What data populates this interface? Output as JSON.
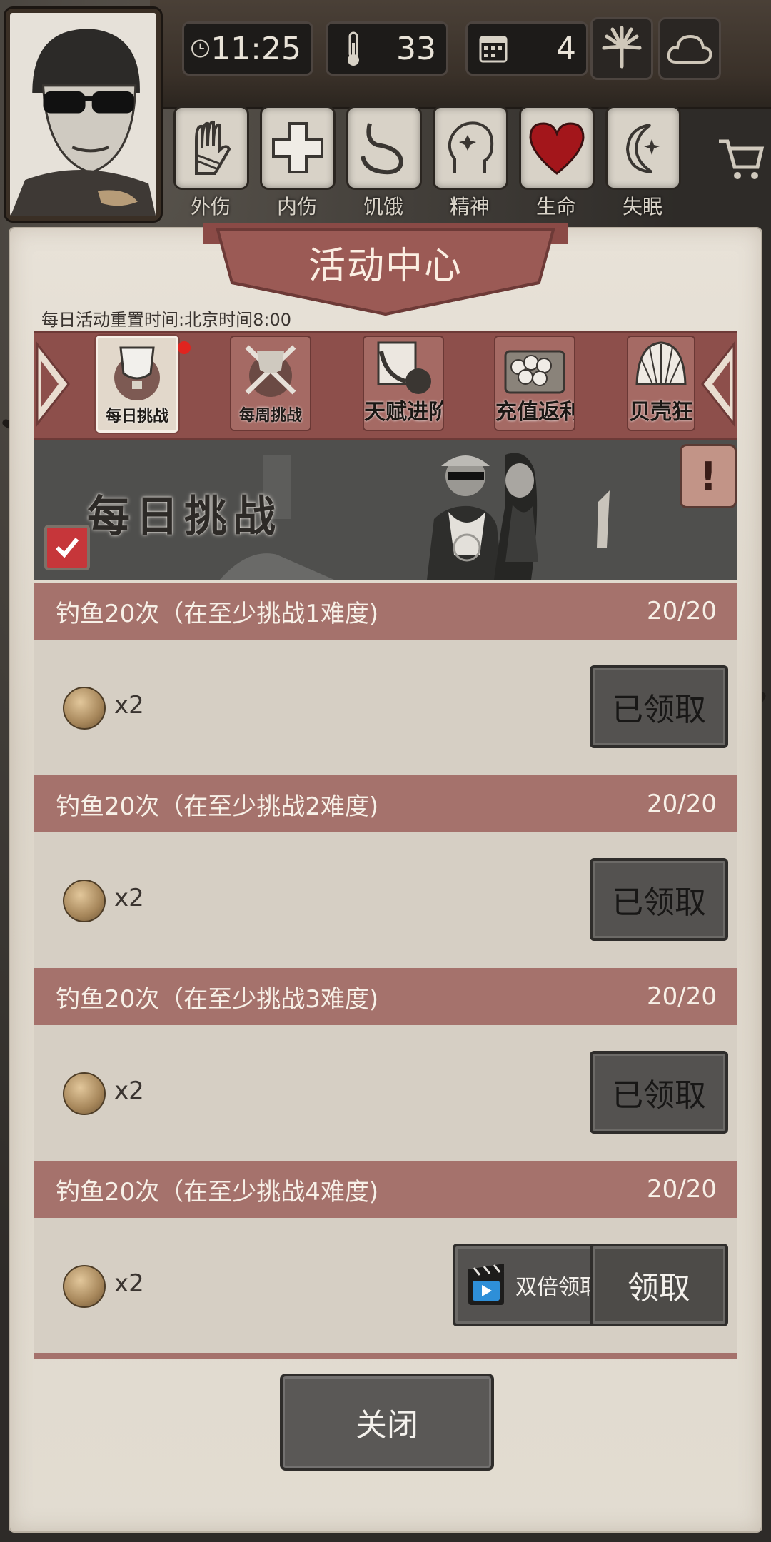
{
  "hud": {
    "time": "11:25",
    "temperature": "33",
    "day": "4",
    "icons": [
      "clock-icon",
      "thermometer-icon",
      "calendar-icon",
      "leaf-icon",
      "cloud-icon",
      "cart-icon"
    ]
  },
  "status": [
    {
      "label": "外伤",
      "icon": "bandaged-hand-icon"
    },
    {
      "label": "内伤",
      "icon": "medical-cross-icon"
    },
    {
      "label": "饥饿",
      "icon": "stomach-icon"
    },
    {
      "label": "精神",
      "icon": "head-icon"
    },
    {
      "label": "生命",
      "icon": "heart-icon"
    },
    {
      "label": "失眠",
      "icon": "moon-icon"
    }
  ],
  "panel": {
    "title": "活动中心",
    "reset_note": "每日活动重置时间:北京时间8:00"
  },
  "tabs": [
    {
      "label": "每日挑战",
      "icon": "trophy-icon",
      "active": true
    },
    {
      "label": "每周挑战",
      "icon": "weapons-icon",
      "active": false
    },
    {
      "label": "天赋进阶",
      "icon": "talent-icon",
      "active": false
    },
    {
      "label": "充值返利",
      "icon": "treasure-chest-icon",
      "active": false
    },
    {
      "label": "贝壳狂",
      "icon": "shell-icon",
      "active": false
    }
  ],
  "hero": {
    "title": "每日挑战",
    "info_label": "!"
  },
  "tasks": [
    {
      "name": "钓鱼20次（在至少挑战1难度)",
      "progress": "20/20",
      "reward_qty": "x2",
      "button": "已领取",
      "claimed": true
    },
    {
      "name": "钓鱼20次（在至少挑战2难度)",
      "progress": "20/20",
      "reward_qty": "x2",
      "button": "已领取",
      "claimed": true
    },
    {
      "name": "钓鱼20次（在至少挑战3难度)",
      "progress": "20/20",
      "reward_qty": "x2",
      "button": "已领取",
      "claimed": true
    },
    {
      "name": "钓鱼20次（在至少挑战4难度)",
      "progress": "20/20",
      "reward_qty": "x2",
      "button": "领取",
      "double_button": "双倍领取",
      "claimed": false
    }
  ],
  "close_label": "关闭",
  "colors": {
    "panel": "#e2dcd1",
    "accent": "#8d4f4b",
    "task_header": "#a5726c",
    "button": "#545250"
  }
}
